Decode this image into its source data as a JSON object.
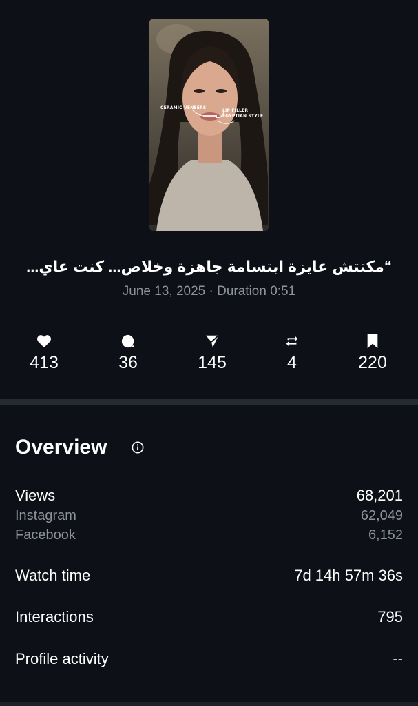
{
  "post": {
    "caption": "“مكنتش عايزة ابتسامة جاهزة وخلاص... كنت عاي...",
    "date": "June 13, 2025",
    "separator": "·",
    "duration": "Duration 0:51",
    "annotations": {
      "left": "CERAMIC VENEERS",
      "right_line1": "LIP FILLER",
      "right_line2": "EGYPTIAN STYLE"
    }
  },
  "stats": {
    "likes": "413",
    "comments": "36",
    "shares": "145",
    "reposts": "4",
    "saves": "220"
  },
  "overview": {
    "title": "Overview",
    "rows": {
      "views_label": "Views",
      "views_value": "68,201",
      "instagram_label": "Instagram",
      "instagram_value": "62,049",
      "facebook_label": "Facebook",
      "facebook_value": "6,152",
      "watch_label": "Watch time",
      "watch_value": "7d 14h 57m 36s",
      "interactions_label": "Interactions",
      "interactions_value": "795",
      "profile_label": "Profile activity",
      "profile_value": "--"
    }
  },
  "colors": {
    "background": "#0d1016",
    "muted_text": "#8e929b",
    "divider": "#262a31"
  }
}
